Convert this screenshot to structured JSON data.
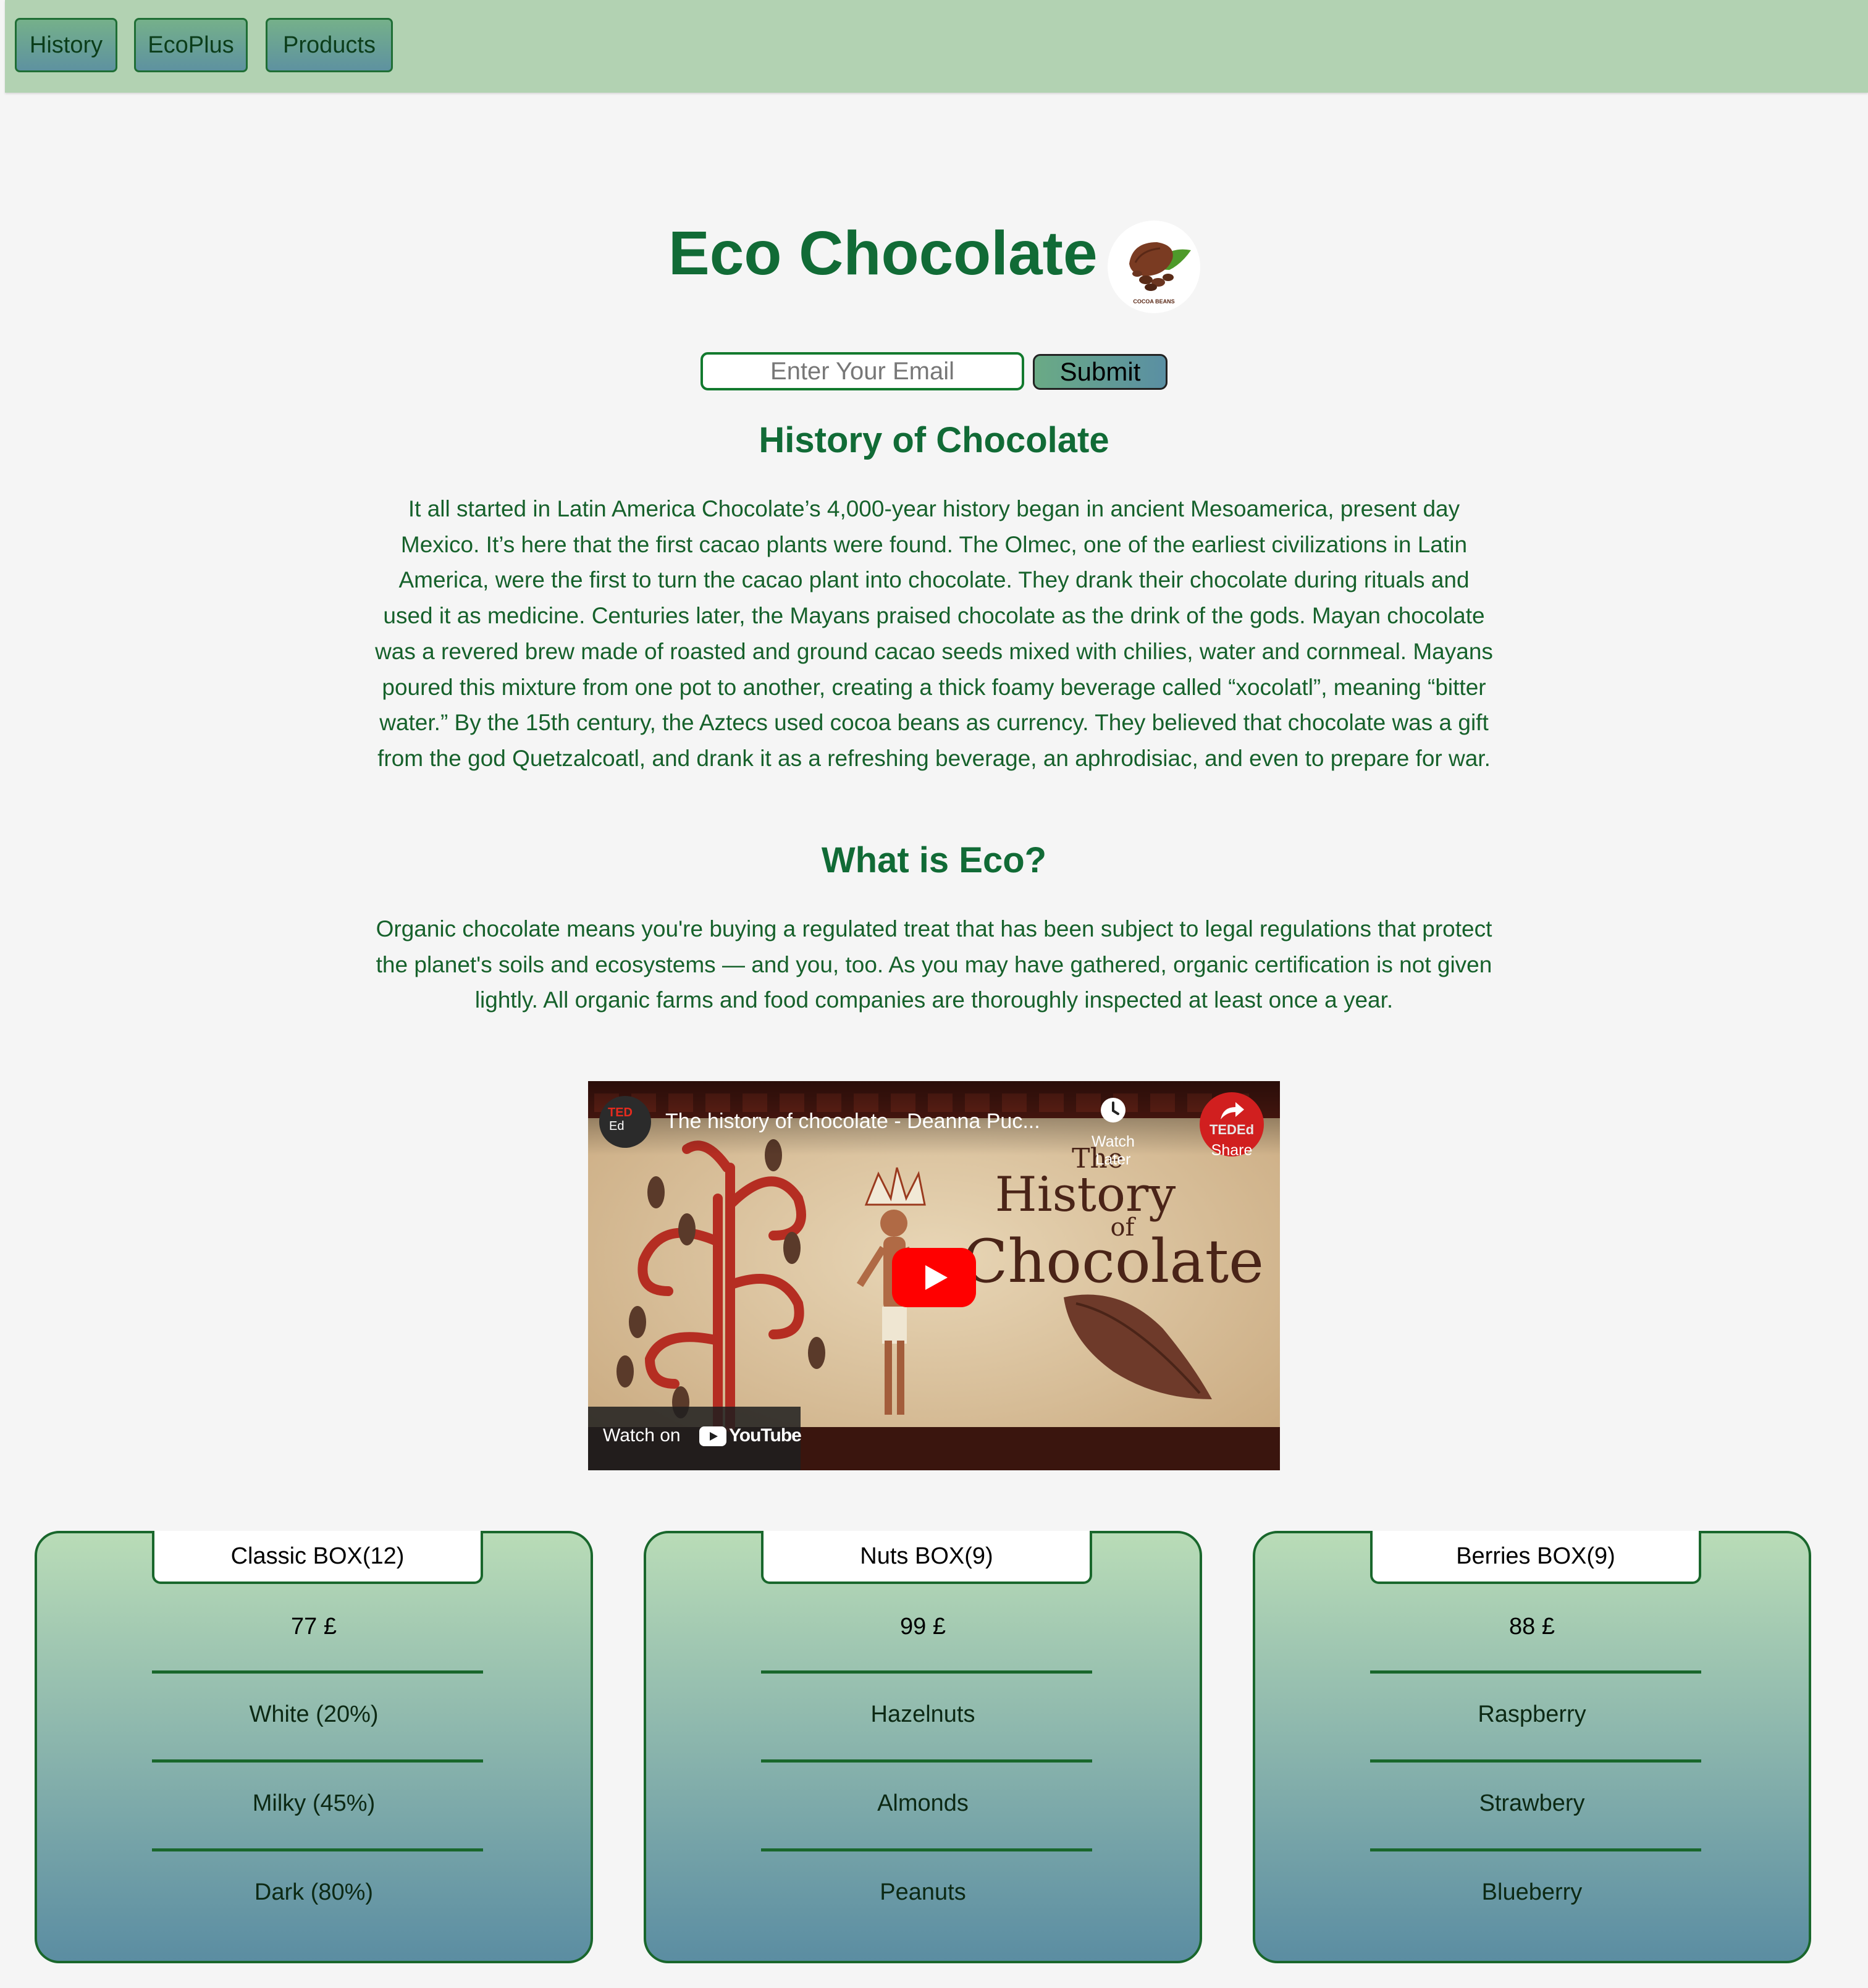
{
  "nav": {
    "items": [
      {
        "label": "History"
      },
      {
        "label": "EcoPlus"
      },
      {
        "label": "Products"
      }
    ]
  },
  "header": {
    "title": "Eco Chocolate",
    "logo": {
      "name": "cocoa-beans-logo",
      "caption": "COCOA BEANS"
    }
  },
  "signup": {
    "email_placeholder": "Enter Your Email",
    "submit_label": "Submit"
  },
  "history": {
    "heading": "History of Chocolate",
    "body": "It all started in Latin America Chocolate’s 4,000-year history began in ancient Mesoamerica, present day Mexico. It’s here that the first cacao plants were found. The Olmec, one of the earliest civilizations in Latin America, were the first to turn the cacao plant into chocolate. They drank their chocolate during rituals and used it as medicine. Centuries later, the Mayans praised chocolate as the drink of the gods. Mayan chocolate was a revered brew made of roasted and ground cacao seeds mixed with chilies, water and cornmeal. Mayans poured this mixture from one pot to another, creating a thick foamy beverage called “xocolatl”, meaning “bitter water.” By the 15th century, the Aztecs used cocoa beans as currency. They believed that chocolate was a gift from the god Quetzalcoatl, and drank it as a refreshing beverage, an aphrodisiac, and even to prepare for war."
  },
  "eco": {
    "heading": "What is Eco?",
    "body": "Organic chocolate means you're buying a regulated treat that has been subject to legal regulations that protect the planet's soils and ecosystems — and you, too. As you may have gathered, organic certification is not given lightly. All organic farms and food companies are thoroughly inspected at least once a year."
  },
  "video": {
    "channel_badge_top": "TED",
    "channel_badge_bottom": "Ed",
    "title": "The history of chocolate - Deanna Puc...",
    "watch_later_label": "Watch Later",
    "share_label": "Share",
    "share_badge": "TEDEd",
    "art_title_line1": "The",
    "art_title_line2": "History",
    "art_title_line3": "of",
    "art_title_line4": "Chocolate",
    "watch_on_label": "Watch on",
    "youtube_label": "YouTube"
  },
  "boxes": [
    {
      "name": "Classic BOX(12)",
      "price": "77 £",
      "items": [
        "White (20%)",
        "Milky (45%)",
        "Dark (80%)"
      ]
    },
    {
      "name": "Nuts BOX(9)",
      "price": "99 £",
      "items": [
        "Hazelnuts",
        "Almonds",
        "Peanuts"
      ]
    },
    {
      "name": "Berries BOX(9)",
      "price": "88 £",
      "items": [
        "Raspberry",
        "Strawbery",
        "Blueberry"
      ]
    }
  ],
  "colors": {
    "nav_background": "#b2d2b2",
    "brand_green": "#116b36",
    "text_green": "#16612b",
    "card_gradient_top": "#b9dcb7",
    "card_gradient_bottom": "#5b8da2",
    "youtube_red": "#ff0000"
  },
  "icons": [
    "play-icon",
    "clock-icon",
    "share-arrow-icon",
    "youtube-logo-icon",
    "cocoa-pod-icon"
  ]
}
